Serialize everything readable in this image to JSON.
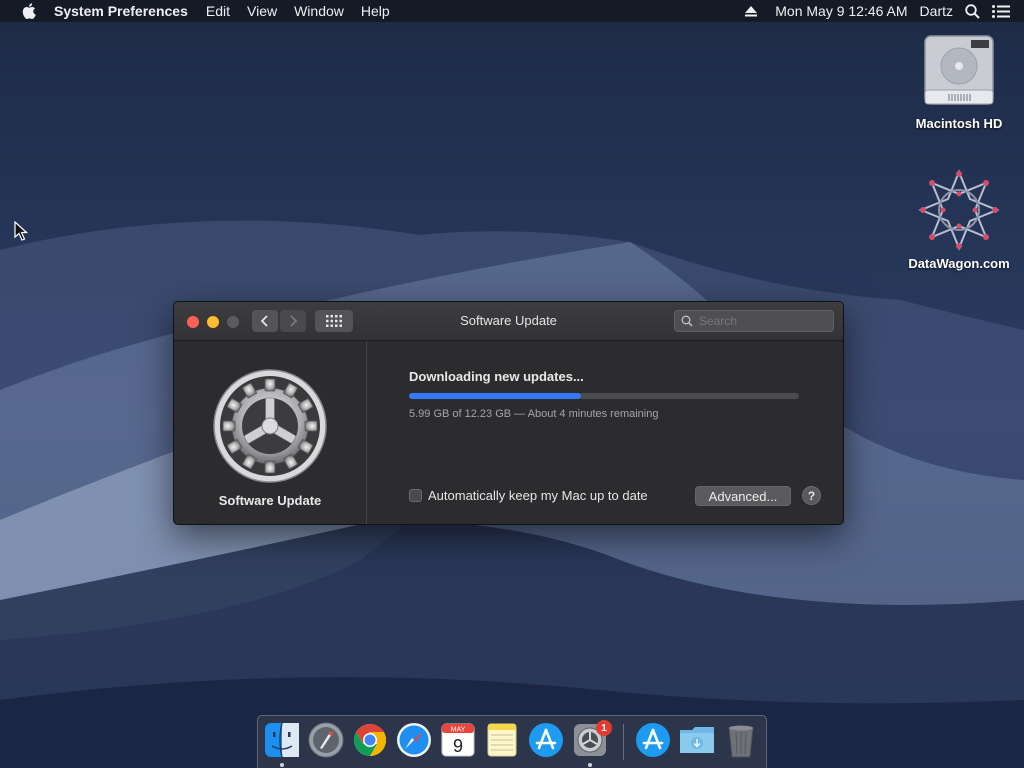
{
  "menubar": {
    "app_name": "System Preferences",
    "items": [
      "Edit",
      "View",
      "Window",
      "Help"
    ],
    "date_time": "Mon May 9  12:46 AM",
    "user": "Dartz",
    "icons": [
      "apple-icon",
      "eject-icon",
      "spotlight-search-icon",
      "notification-center-icon"
    ]
  },
  "desktop": {
    "icons": [
      {
        "label": "Macintosh HD",
        "icon": "hard-drive-icon"
      },
      {
        "label": "DataWagon.com",
        "icon": "datawagon-logo-icon"
      }
    ]
  },
  "window": {
    "title": "Software Update",
    "search_placeholder": "Search",
    "sidebar_label": "Software Update",
    "status_title": "Downloading new updates...",
    "progress_fraction": 0.44,
    "progress_detail": "5.99 GB of 12.23 GB — About 4 minutes remaining",
    "auto_update_label": "Automatically keep my Mac up to date",
    "auto_update_checked": false,
    "advanced_label": "Advanced...",
    "help_label": "?"
  },
  "dock": {
    "items": [
      {
        "name": "Finder",
        "icon": "finder-icon",
        "running": true
      },
      {
        "name": "Launchpad",
        "icon": "launchpad-icon",
        "running": false
      },
      {
        "name": "Google Chrome",
        "icon": "chrome-icon",
        "running": false
      },
      {
        "name": "Safari",
        "icon": "safari-icon",
        "running": false
      },
      {
        "name": "Calendar",
        "icon": "calendar-icon",
        "running": false,
        "month": "MAY",
        "day": "9"
      },
      {
        "name": "Notes",
        "icon": "notes-icon",
        "running": false
      },
      {
        "name": "App Store",
        "icon": "app-store-icon",
        "running": false
      },
      {
        "name": "System Preferences",
        "icon": "system-preferences-icon",
        "running": true,
        "badge": "1"
      },
      {
        "name": "App Store Downloads",
        "icon": "app-store-icon",
        "running": false
      },
      {
        "name": "Downloads",
        "icon": "downloads-folder-icon",
        "running": false
      },
      {
        "name": "Trash",
        "icon": "trash-icon",
        "running": false
      }
    ]
  },
  "colors": {
    "progress": "#3478f6",
    "close": "#fc5f57",
    "minimize": "#fdbd2e",
    "badge": "#e23c32"
  }
}
